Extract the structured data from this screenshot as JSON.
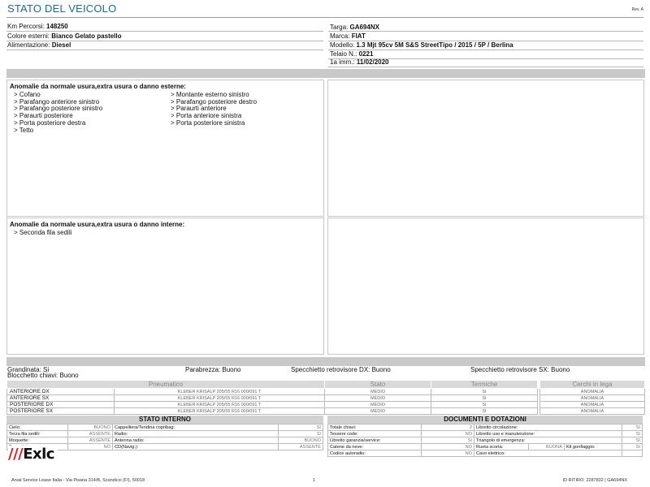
{
  "header": {
    "title": "STATO DEL VEICOLO",
    "rev": "Rev. A"
  },
  "vehicle_left": [
    {
      "label": "Km Percorsi:",
      "value": "148250"
    },
    {
      "label": "Colore esterni:",
      "value": "Bianco Gelato pastello"
    },
    {
      "label": "Alimentazione:",
      "value": "Diesel"
    }
  ],
  "vehicle_right": [
    {
      "label": "Targa:",
      "value": "GA694NX"
    },
    {
      "label": "Marca:",
      "value": "FIAT"
    },
    {
      "label": "Modello:",
      "value": "1.3 Mjt 95cv 5M S&S StreetTipo / 2015 / 5P / Berlina"
    },
    {
      "label": "Telaio N.:",
      "value": "0221"
    },
    {
      "label": "1a imm.:",
      "value": "11/02/2020"
    }
  ],
  "external_damage": {
    "title": "Anomalie da normale usura,extra usura o danno esterne:",
    "col1": [
      "> Cofano",
      "> Parafango anteriore sinistro",
      "> Parafango posteriore sinistro",
      "> Paraurti posteriore",
      "> Porta posteriore destra",
      "> Tetto"
    ],
    "col2": [
      "> Montante esterno sinistro",
      "> Parafango posteriore destro",
      "> Paraurti anteriore",
      "> Porta anteriore sinistra",
      "> Porta posteriore sinistra"
    ]
  },
  "internal_damage": {
    "title": "Anomalie da normale usura,extra usura o danno interne:",
    "items": [
      "> Seconda fila sedili"
    ]
  },
  "conditions": {
    "grandinata": "Grandinata: Si",
    "parabrezza": "Parabrezza: Buono",
    "specchietto_dx": "Specchietto retrovisore DX: Buono",
    "specchietto_sx": "Specchietto retrovisore SX: Buono",
    "blocchetto": "Blocchetto chiavi: Buono"
  },
  "tyres": {
    "headers": [
      "Pneumatico",
      "Stato",
      "Termiche"
    ],
    "rows": [
      {
        "pos": "ANTERIORE DX",
        "desc": "KLEBER KRISALP 205/55 R16 000/091 T",
        "stato": "MEDIO",
        "termiche": "SI"
      },
      {
        "pos": "ANTERIORE SX",
        "desc": "KLEBER KRISALP 205/55 R16 000/091 T",
        "stato": "MEDIO",
        "termiche": "SI"
      },
      {
        "pos": "POSTERIORE DX",
        "desc": "KLEBER KRISALP 205/55 R16 000/091 T",
        "stato": "MEDIO",
        "termiche": "SI"
      },
      {
        "pos": "POSTERIORE SX",
        "desc": "KLEBER KRISALP 205/55 R16 000/091 T",
        "stato": "MEDIO",
        "termiche": "SI"
      }
    ]
  },
  "cerchi": {
    "header": "Cerchi in lega",
    "rows": [
      "ANOMALIA",
      "ANOMALIA",
      "ANOMALIA",
      "ANOMALIA"
    ]
  },
  "stato_interno": {
    "title": "STATO INTERNO",
    "rows": [
      [
        {
          "l": "Cielo:",
          "v": "BUONO"
        },
        {
          "l": "Cappelliera/Tendina copribag:",
          "v": "SI"
        }
      ],
      [
        {
          "l": "Terza fila sedili:",
          "v": "ASSENTE"
        },
        {
          "l": "Radio:",
          "v": "SI"
        }
      ],
      [
        {
          "l": "Moquette:",
          "v": "ASSENTE"
        },
        {
          "l": "Antenna radio:",
          "v": "BUONO"
        }
      ],
      [
        {
          "l": "Tappetini:",
          "v": "NO"
        },
        {
          "l": "CD(Navig.):",
          "v": "ASSENTE"
        }
      ]
    ]
  },
  "documenti": {
    "title": "DOCUMENTI E DOTAZIONI",
    "rows": [
      [
        {
          "l": "Totale chiavi:",
          "v": "2"
        },
        {
          "l": "Libretto circolazione:",
          "v": "SI"
        }
      ],
      [
        {
          "l": "Tessere code:",
          "v": "NO"
        },
        {
          "l": "Libretto uso e manutenzione:",
          "v": "SI"
        }
      ],
      [
        {
          "l": "Libretto garanzia/service:",
          "v": "SI"
        },
        {
          "l": "Triangolo di emergenza:",
          "v": "SI"
        }
      ],
      [
        {
          "l": "Catene da neve:",
          "v": "NO"
        },
        {
          "l": "Ruota scorta:",
          "v": "BUONA",
          "l2": "Kit gonfiaggio:",
          "v2": "SI"
        }
      ],
      [
        {
          "l": "Codice autoradio:",
          "v": "NO"
        },
        {
          "l": "Cavo elettrico:",
          "v": ""
        }
      ]
    ]
  },
  "logo": {
    "bars": "///",
    "text": "Exlc"
  },
  "footer": {
    "address": "Arval Service Lease Italia - Via Pisana 314/B, Scandicci (FI), 50018",
    "page": "1",
    "id": "ID RITIRO: 2287832 | GA694NX"
  }
}
